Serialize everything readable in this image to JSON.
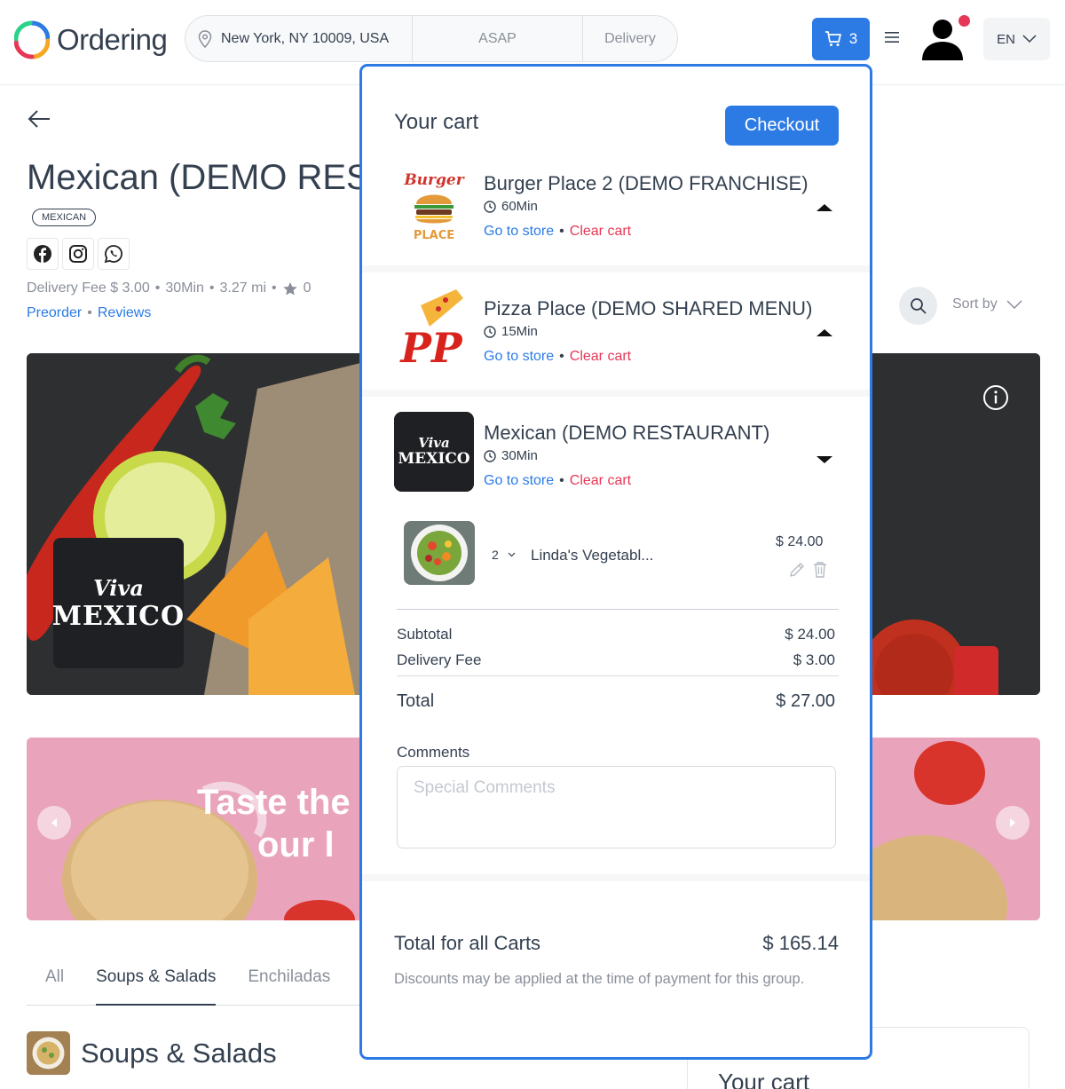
{
  "header": {
    "logo_text": "Ordering",
    "address": "New York, NY 10009, USA",
    "time": "ASAP",
    "order_type": "Delivery",
    "cart_count": "3",
    "language": "EN"
  },
  "store": {
    "title": "Mexican (DEMO REST",
    "category": "MEXICAN",
    "delivery_fee": "Delivery Fee $ 3.00",
    "time": "30Min",
    "distance": "3.27 mi",
    "rating": "0",
    "dot": "•",
    "preorder": "Preorder",
    "reviews": "Reviews",
    "sort_by": "Sort by",
    "logo_line1": "Viva",
    "logo_line2": "MEXICO"
  },
  "banner": {
    "line1": "Taste the",
    "line2": "our l"
  },
  "tabs": [
    "All",
    "Soups & Salads",
    "Enchiladas"
  ],
  "section_title": "Soups & Salads",
  "side_cart_title": "Your cart",
  "cart": {
    "title": "Your cart",
    "checkout": "Checkout",
    "go_to_store": "Go to store",
    "clear_cart": "Clear cart",
    "dot": "•",
    "businesses": [
      {
        "name": "Burger Place 2 (DEMO FRANCHISE)",
        "time": "60Min",
        "logo_text_top": "Burger",
        "logo_text_bottom": "PLACE"
      },
      {
        "name": "Pizza Place (DEMO SHARED MENU)",
        "time": "15Min",
        "logo_text": "PP"
      },
      {
        "name": "Mexican (DEMO RESTAURANT)",
        "time": "30Min",
        "logo_line1": "Viva",
        "logo_line2": "MEXICO"
      }
    ],
    "product": {
      "quantity": "2",
      "name": "Linda's Vegetabl...",
      "price": "$ 24.00"
    },
    "subtotal_label": "Subtotal",
    "subtotal_value": "$ 24.00",
    "delivery_fee_label": "Delivery Fee",
    "delivery_fee_value": "$ 3.00",
    "total_label": "Total",
    "total_value": "$ 27.00",
    "comments_label": "Comments",
    "comments_placeholder": "Special Comments",
    "total_all_label": "Total for all Carts",
    "total_all_value": "$ 165.14",
    "discount_note": "Discounts may be applied at the time of payment for this group."
  },
  "colors": {
    "primary": "#2c7be5",
    "danger": "#e63757",
    "text": "#344050",
    "muted": "#8a8f99"
  }
}
